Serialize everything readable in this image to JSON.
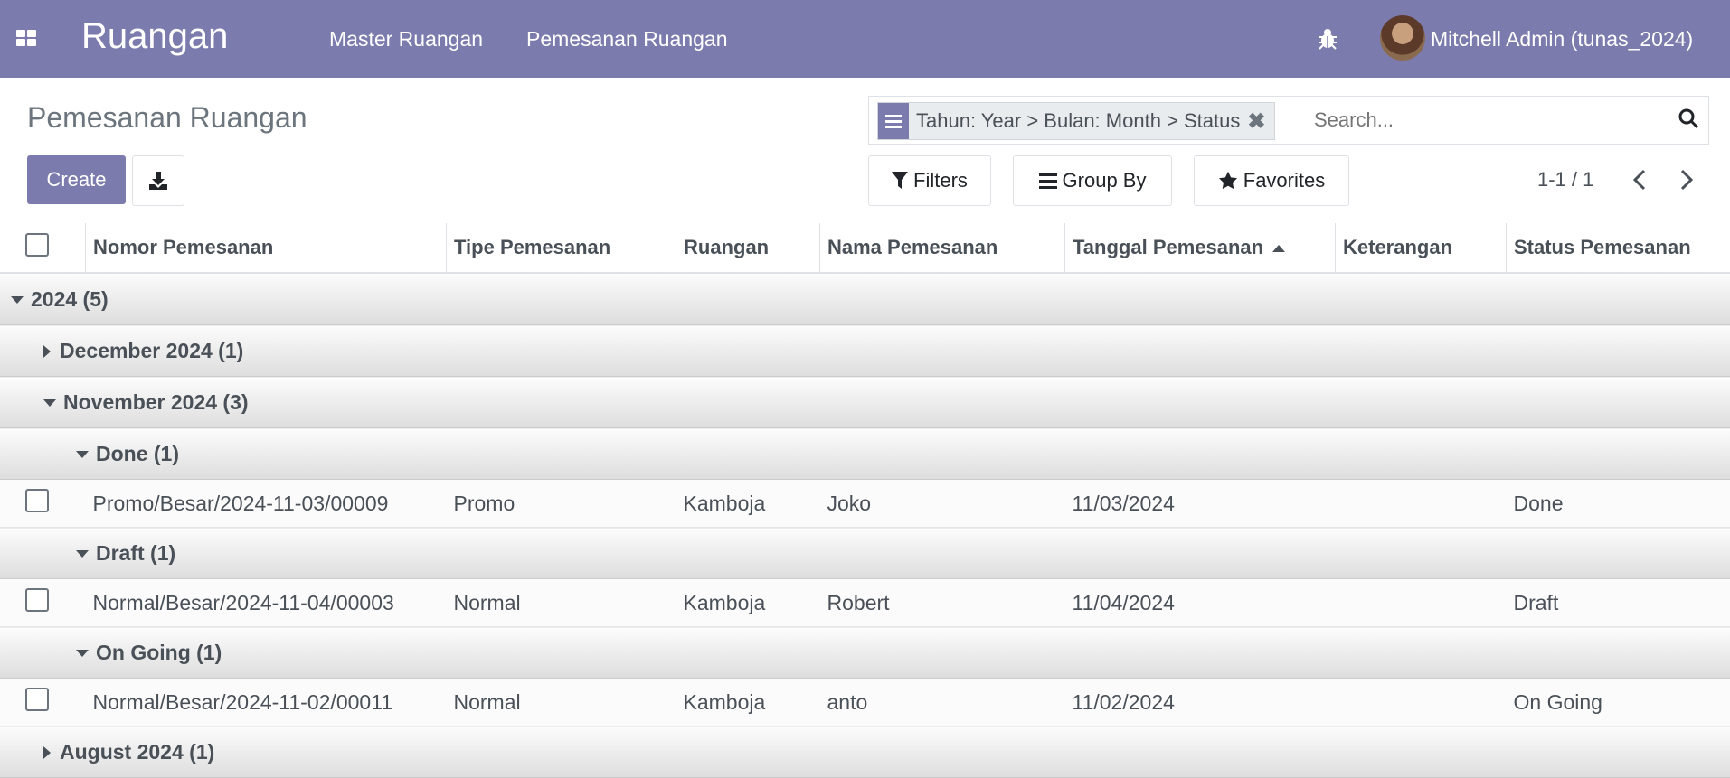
{
  "navbar": {
    "app_title": "Ruangan",
    "menu": [
      "Master Ruangan",
      "Pemesanan Ruangan"
    ],
    "user_name": "Mitchell Admin (tunas_2024)"
  },
  "control": {
    "breadcrumb": "Pemesanan Ruangan",
    "create_label": "Create",
    "search": {
      "facet": "Tahun: Year > Bulan: Month > Status",
      "placeholder": "Search..."
    },
    "filters_label": "Filters",
    "groupby_label": "Group By",
    "favorites_label": "Favorites",
    "pager": "1-1 / 1"
  },
  "table": {
    "columns": [
      "Nomor Pemesanan",
      "Tipe Pemesanan",
      "Ruangan",
      "Nama Pemesanan",
      "Tanggal Pemesanan",
      "Keterangan",
      "Status Pemesanan"
    ],
    "groups": {
      "year": "2024 (5)",
      "dec": "December 2024 (1)",
      "nov": "November 2024 (3)",
      "done": "Done (1)",
      "draft": "Draft (1)",
      "ongoing": "On Going (1)",
      "aug": "August 2024 (1)"
    },
    "rows": [
      {
        "nomor": "Promo/Besar/2024-11-03/00009",
        "tipe": "Promo",
        "ruangan": "Kamboja",
        "nama": "Joko",
        "tanggal": "11/03/2024",
        "keterangan": "",
        "status": "Done"
      },
      {
        "nomor": "Normal/Besar/2024-11-04/00003",
        "tipe": "Normal",
        "ruangan": "Kamboja",
        "nama": "Robert",
        "tanggal": "11/04/2024",
        "keterangan": "",
        "status": "Draft"
      },
      {
        "nomor": "Normal/Besar/2024-11-02/00011",
        "tipe": "Normal",
        "ruangan": "Kamboja",
        "nama": "anto",
        "tanggal": "11/02/2024",
        "keterangan": "",
        "status": "On Going"
      }
    ]
  }
}
